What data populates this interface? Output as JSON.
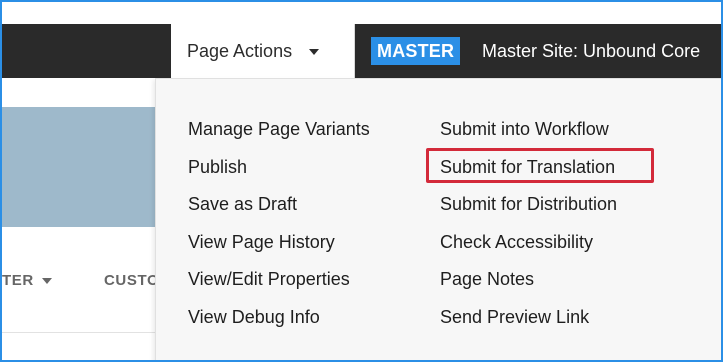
{
  "topbar": {
    "page_actions_label": "Page Actions",
    "badge": "MASTER",
    "site_name": "Master Site: Unbound Core",
    "badge_color": "#2b8fe6"
  },
  "left_nav": {
    "filter_label": "TER",
    "cust_label": "CUSTO"
  },
  "menu": {
    "left_items": [
      "Manage Page Variants",
      "Publish",
      "Save as Draft",
      "View Page History",
      "View/Edit Properties",
      "View Debug Info"
    ],
    "right_items": [
      "Submit into Workflow",
      "Submit for Translation",
      "Submit for Distribution",
      "Check Accessibility",
      "Page Notes",
      "Send Preview Link"
    ],
    "highlighted_item": "Submit for Translation",
    "highlight_color": "#d32a3a"
  },
  "icons": {
    "page_actions_caret": "chevron-down-icon",
    "nav_caret": "chevron-down-icon"
  }
}
